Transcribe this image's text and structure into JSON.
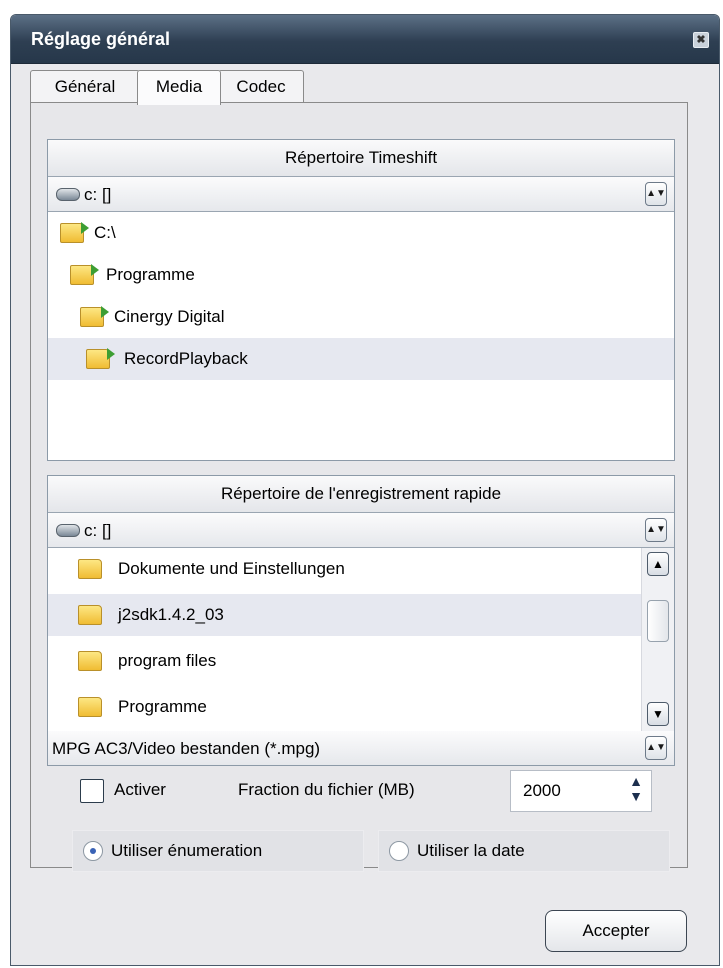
{
  "window": {
    "title": "Réglage général",
    "close_icon": "close-icon"
  },
  "tabs": [
    {
      "label": "Général"
    },
    {
      "label": "Media",
      "active": true
    },
    {
      "label": "Codec"
    }
  ],
  "timeshift": {
    "header": "Répertoire Timeshift",
    "drive": "c: []",
    "folders": [
      {
        "label": "C:\\"
      },
      {
        "label": "Programme"
      },
      {
        "label": "Cinergy Digital"
      },
      {
        "label": "RecordPlayback",
        "selected": true
      }
    ]
  },
  "quick_record": {
    "header": "Répertoire  de l'enregistrement rapide",
    "drive": "c: []",
    "folders": [
      {
        "label": "Dokumente und Einstellungen"
      },
      {
        "label": "j2sdk1.4.2_03",
        "selected": true
      },
      {
        "label": "program files"
      },
      {
        "label": "Programme"
      }
    ],
    "file_type": "MPG AC3/Video bestanden (*.mpg)"
  },
  "options": {
    "activate_label": "Activer",
    "activate_checked": false,
    "fraction_label": "Fraction du fichier (MB)",
    "fraction_value": "2000",
    "radio_enum": "Utiliser énumeration",
    "radio_date": "Utiliser la date",
    "selected_radio": "enumeration"
  },
  "accept_label": "Accepter"
}
